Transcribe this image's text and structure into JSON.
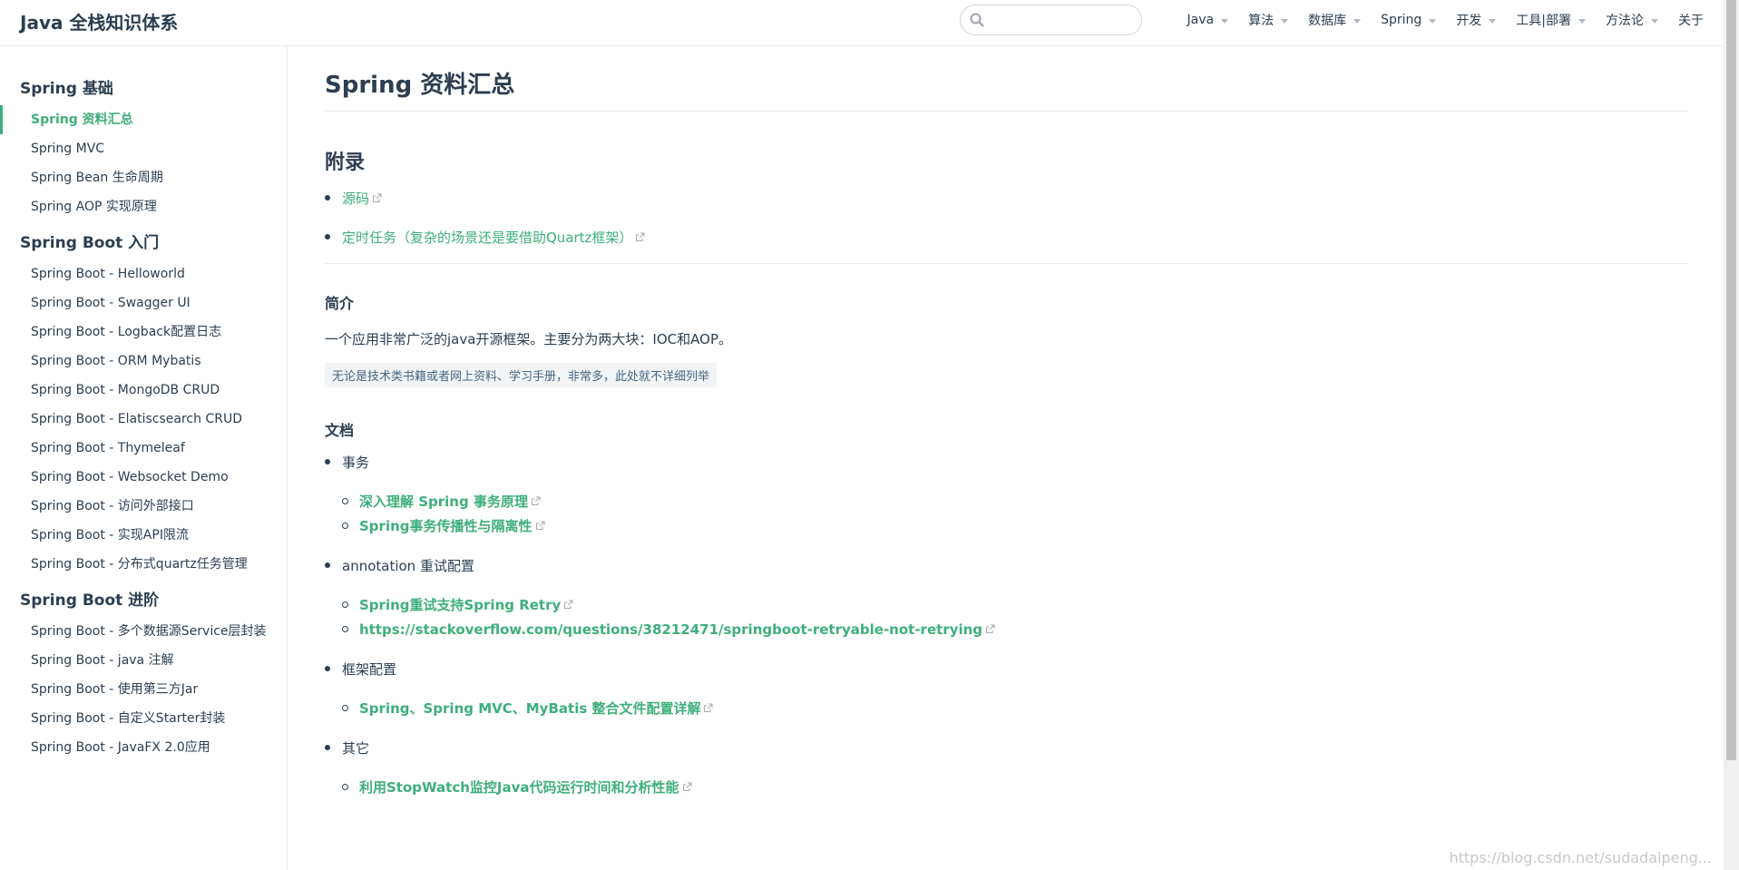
{
  "navbar": {
    "site_name": "Java 全栈知识体系",
    "search_placeholder": "",
    "items": [
      {
        "label": "Java",
        "dropdown": true
      },
      {
        "label": "算法",
        "dropdown": true
      },
      {
        "label": "数据库",
        "dropdown": true
      },
      {
        "label": "Spring",
        "dropdown": true
      },
      {
        "label": "开发",
        "dropdown": true
      },
      {
        "label": "工具|部署",
        "dropdown": true
      },
      {
        "label": "方法论",
        "dropdown": true
      },
      {
        "label": "关于",
        "dropdown": false
      }
    ]
  },
  "sidebar": {
    "groups": [
      {
        "title": "Spring 基础",
        "items": [
          "Spring 资料汇总",
          "Spring MVC",
          "Spring Bean 生命周期",
          "Spring AOP 实现原理"
        ]
      },
      {
        "title": "Spring Boot 入门",
        "items": [
          "Spring Boot - Helloworld",
          "Spring Boot - Swagger UI",
          "Spring Boot - Logback配置日志",
          "Spring Boot - ORM Mybatis",
          "Spring Boot - MongoDB CRUD",
          "Spring Boot - Elatiscsearch CRUD",
          "Spring Boot - Thymeleaf",
          "Spring Boot - Websocket Demo",
          "Spring Boot - 访问外部接口",
          "Spring Boot - 实现API限流",
          "Spring Boot - 分布式quartz任务管理"
        ]
      },
      {
        "title": "Spring Boot 进阶",
        "items": [
          "Spring Boot - 多个数据源Service层封装",
          "Spring Boot - java 注解",
          "Spring Boot - 使用第三方Jar",
          "Spring Boot - 自定义Starter封装",
          "Spring Boot - JavaFX 2.0应用"
        ]
      }
    ],
    "active": "Spring 资料汇总"
  },
  "main": {
    "title": "Spring 资料汇总",
    "appendix_heading": "附录",
    "appendix_links": [
      "源码",
      "定时任务（复杂的场景还是要借助Quartz框架）"
    ],
    "intro_heading": "简介",
    "intro_text": "一个应用非常广泛的java开源框架。主要分为两大块：IOC和AOP。",
    "intro_note": "无论是技术类书籍或者网上资料、学习手册，非常多，此处就不详细列举",
    "docs_heading": "文档",
    "docs": [
      {
        "label": "事务",
        "links": [
          "深入理解 Spring 事务原理",
          "Spring事务传播性与隔离性"
        ]
      },
      {
        "label": "annotation 重试配置",
        "links": [
          "Spring重试支持Spring Retry",
          "https://stackoverflow.com/questions/38212471/springboot-retryable-not-retrying"
        ]
      },
      {
        "label": "框架配置",
        "links": [
          "Spring、Spring MVC、MyBatis 整合文件配置详解"
        ]
      },
      {
        "label": "其它",
        "links": [
          "利用StopWatch监控Java代码运行时间和分析性能"
        ]
      }
    ]
  },
  "watermark": "https://blog.csdn.net/sudadaipeng...",
  "colors": {
    "accent": "#3eaf7c",
    "text": "#2c3e50",
    "border": "#eaecef"
  }
}
